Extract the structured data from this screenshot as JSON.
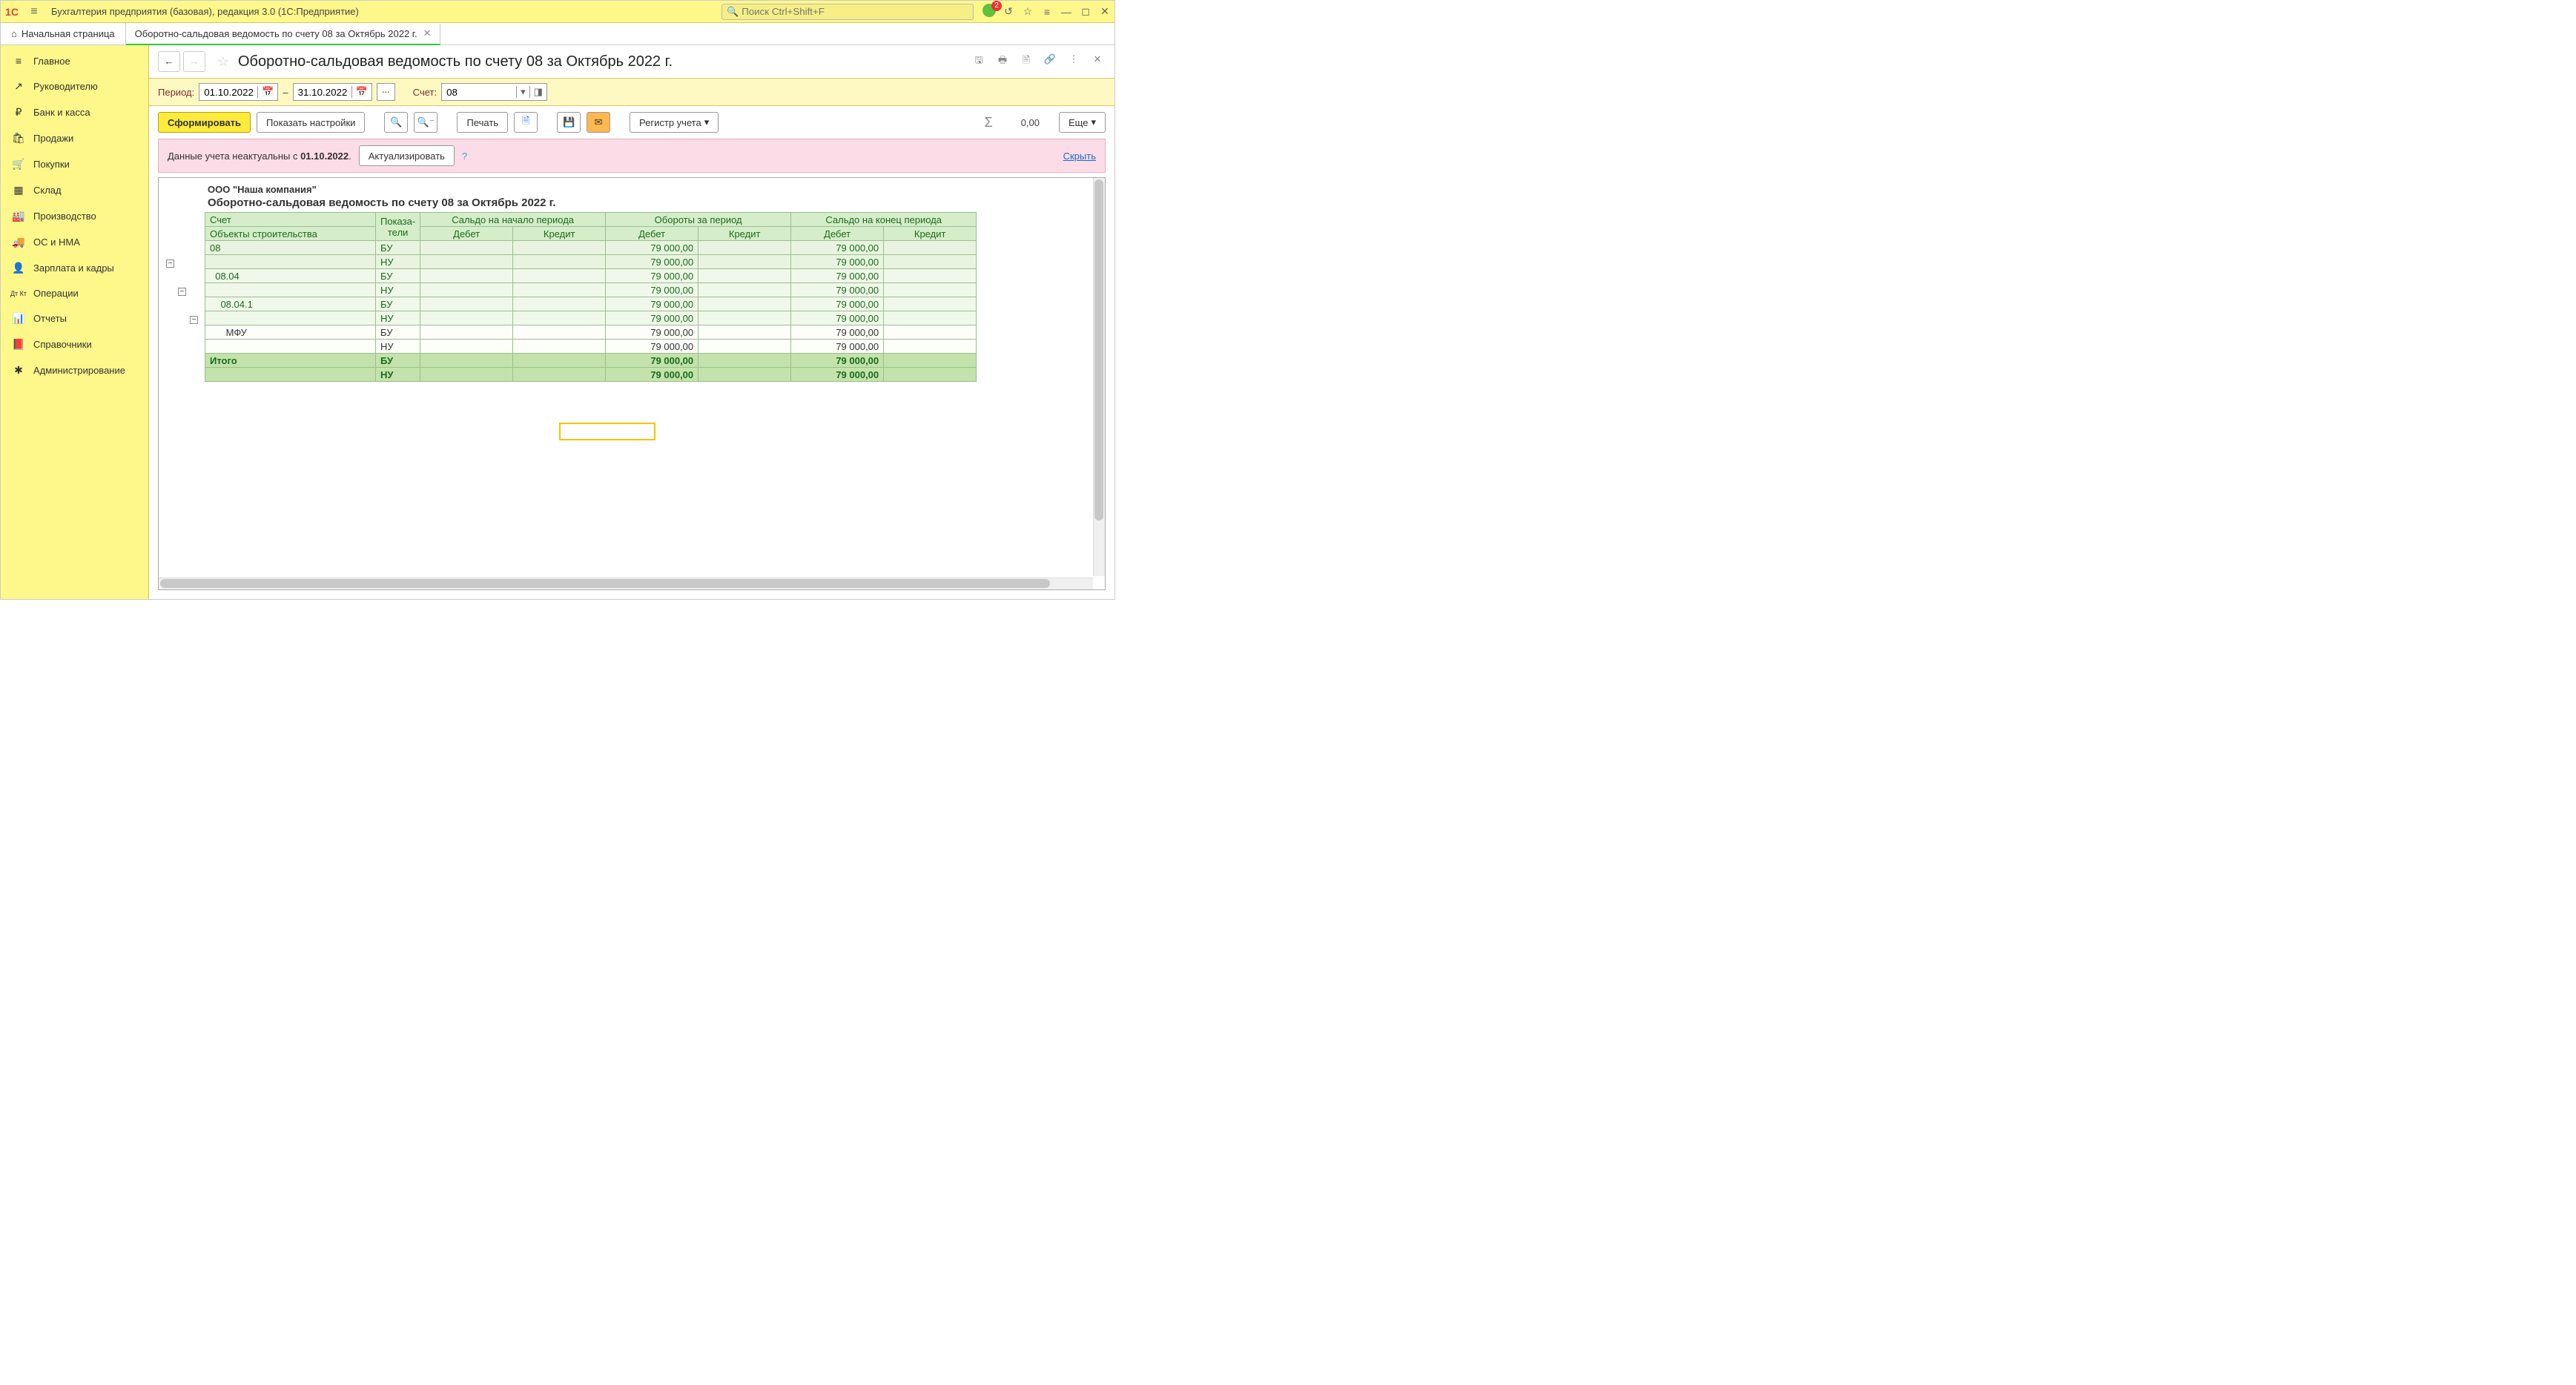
{
  "app": {
    "title": "Бухгалтерия предприятия (базовая), редакция 3.0  (1С:Предприятие)",
    "search_placeholder": "Поиск Ctrl+Shift+F",
    "notification_count": "2"
  },
  "tabs": {
    "home": "Начальная страница",
    "active": "Оборотно-сальдовая ведомость по счету 08 за Октябрь 2022 г."
  },
  "sidebar": [
    {
      "icon": "≡",
      "label": "Главное"
    },
    {
      "icon": "↗",
      "label": "Руководителю"
    },
    {
      "icon": "₽",
      "label": "Банк и касса"
    },
    {
      "icon": "🛍",
      "label": "Продажи"
    },
    {
      "icon": "🛒",
      "label": "Покупки"
    },
    {
      "icon": "▦",
      "label": "Склад"
    },
    {
      "icon": "🏭",
      "label": "Производство"
    },
    {
      "icon": "🚚",
      "label": "ОС и НМА"
    },
    {
      "icon": "👤",
      "label": "Зарплата и кадры"
    },
    {
      "icon": "Дт Кт",
      "label": "Операции"
    },
    {
      "icon": "📊",
      "label": "Отчеты"
    },
    {
      "icon": "📕",
      "label": "Справочники"
    },
    {
      "icon": "✱",
      "label": "Администрирование"
    }
  ],
  "page": {
    "title": "Оборотно-сальдовая ведомость по счету 08 за Октябрь 2022 г."
  },
  "params": {
    "period_label": "Период:",
    "date_from": "01.10.2022",
    "dash": "–",
    "date_to": "31.10.2022",
    "dots": "...",
    "account_label": "Счет:",
    "account": "08"
  },
  "toolbar": {
    "form": "Сформировать",
    "show_settings": "Показать настройки",
    "print": "Печать",
    "register": "Регистр учета",
    "sum_value": "0,00",
    "more": "Еще"
  },
  "warning": {
    "text_prefix": "Данные учета неактуальны с ",
    "date": "01.10.2022",
    "dot": ".",
    "actualize": "Актуализировать",
    "help": "?",
    "hide": "Скрыть"
  },
  "report": {
    "company": "ООО \"Наша компания\"",
    "title": "Оборотно-сальдовая ведомость по счету 08 за Октябрь 2022 г.",
    "headers": {
      "account": "Счет",
      "indicators": "Показа-\nтели",
      "objects": "Объекты строительства",
      "saldo_begin": "Сальдо на начало периода",
      "turnover": "Обороты за период",
      "saldo_end": "Сальдо на конец периода",
      "debit": "Дебет",
      "credit": "Кредит"
    },
    "rows": [
      {
        "acct": "08",
        "ind": "БУ",
        "sb_d": "",
        "sb_c": "",
        "t_d": "79 000,00",
        "t_c": "",
        "se_d": "79 000,00",
        "se_c": "",
        "cls": "data"
      },
      {
        "acct": "",
        "ind": "НУ",
        "sb_d": "",
        "sb_c": "",
        "t_d": "79 000,00",
        "t_c": "",
        "se_d": "79 000,00",
        "se_c": "",
        "cls": "data"
      },
      {
        "acct": "  08.04",
        "ind": "БУ",
        "sb_d": "",
        "sb_c": "",
        "t_d": "79 000,00",
        "t_c": "",
        "se_d": "79 000,00",
        "se_c": "",
        "cls": "data2"
      },
      {
        "acct": "",
        "ind": "НУ",
        "sb_d": "",
        "sb_c": "",
        "t_d": "79 000,00",
        "t_c": "",
        "se_d": "79 000,00",
        "se_c": "",
        "cls": "data2"
      },
      {
        "acct": "    08.04.1",
        "ind": "БУ",
        "sb_d": "",
        "sb_c": "",
        "t_d": "79 000,00",
        "t_c": "",
        "se_d": "79 000,00",
        "se_c": "",
        "cls": "data2"
      },
      {
        "acct": "",
        "ind": "НУ",
        "sb_d": "",
        "sb_c": "",
        "t_d": "79 000,00",
        "t_c": "",
        "se_d": "79 000,00",
        "se_c": "",
        "cls": "data2"
      },
      {
        "acct": "      МФУ",
        "ind": "БУ",
        "sb_d": "",
        "sb_c": "",
        "t_d": "79 000,00",
        "t_c": "",
        "se_d": "79 000,00",
        "se_c": "",
        "cls": "sub"
      },
      {
        "acct": "",
        "ind": "НУ",
        "sb_d": "",
        "sb_c": "",
        "t_d": "79 000,00",
        "t_c": "",
        "se_d": "79 000,00",
        "se_c": "",
        "cls": "sub"
      },
      {
        "acct": "Итого",
        "ind": "БУ",
        "sb_d": "",
        "sb_c": "",
        "t_d": "79 000,00",
        "t_c": "",
        "se_d": "79 000,00",
        "se_c": "",
        "cls": "total"
      },
      {
        "acct": "",
        "ind": "НУ",
        "sb_d": "",
        "sb_c": "",
        "t_d": "79 000,00",
        "t_c": "",
        "se_d": "79 000,00",
        "se_c": "",
        "cls": "total"
      }
    ]
  }
}
